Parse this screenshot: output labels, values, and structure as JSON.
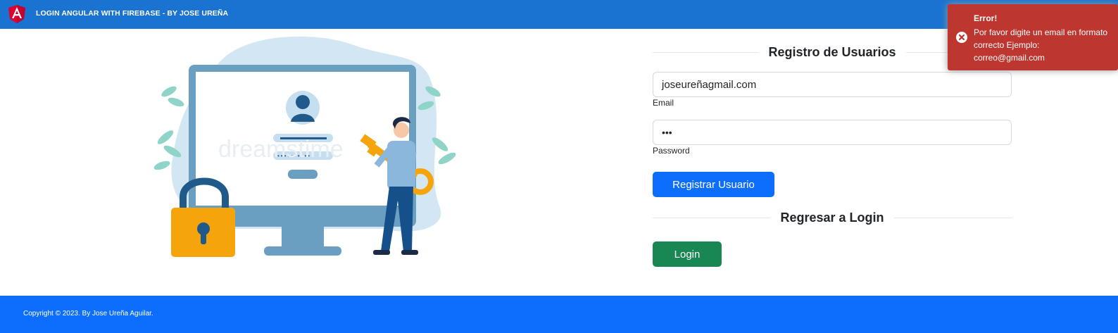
{
  "navbar": {
    "brand": "LOGIN ANGULAR WITH FIREBASE - BY JOSE UREÑA",
    "logo_icon": "angular-logo-icon"
  },
  "illustration": {
    "watermark": "dreamstime"
  },
  "register": {
    "title": "Registro de Usuarios",
    "email_value": "joseureñagmail.com",
    "email_label": "Email",
    "password_value": "•••",
    "password_label": "Password",
    "submit_label": "Registrar Usuario"
  },
  "back_to_login": {
    "title": "Regresar a Login",
    "button_label": "Login"
  },
  "toast": {
    "title": "Error!",
    "message": "Por favor digite un email en formato correcto Ejemplo: correo@gmail.com",
    "icon": "error-circle-icon",
    "color": "#bd362f"
  },
  "footer": {
    "text": "Copyright © 2023. By Jose Ureña Aguilar."
  },
  "colors": {
    "navbar": "#1a73d1",
    "primary": "#0d6efd",
    "success": "#198754"
  }
}
